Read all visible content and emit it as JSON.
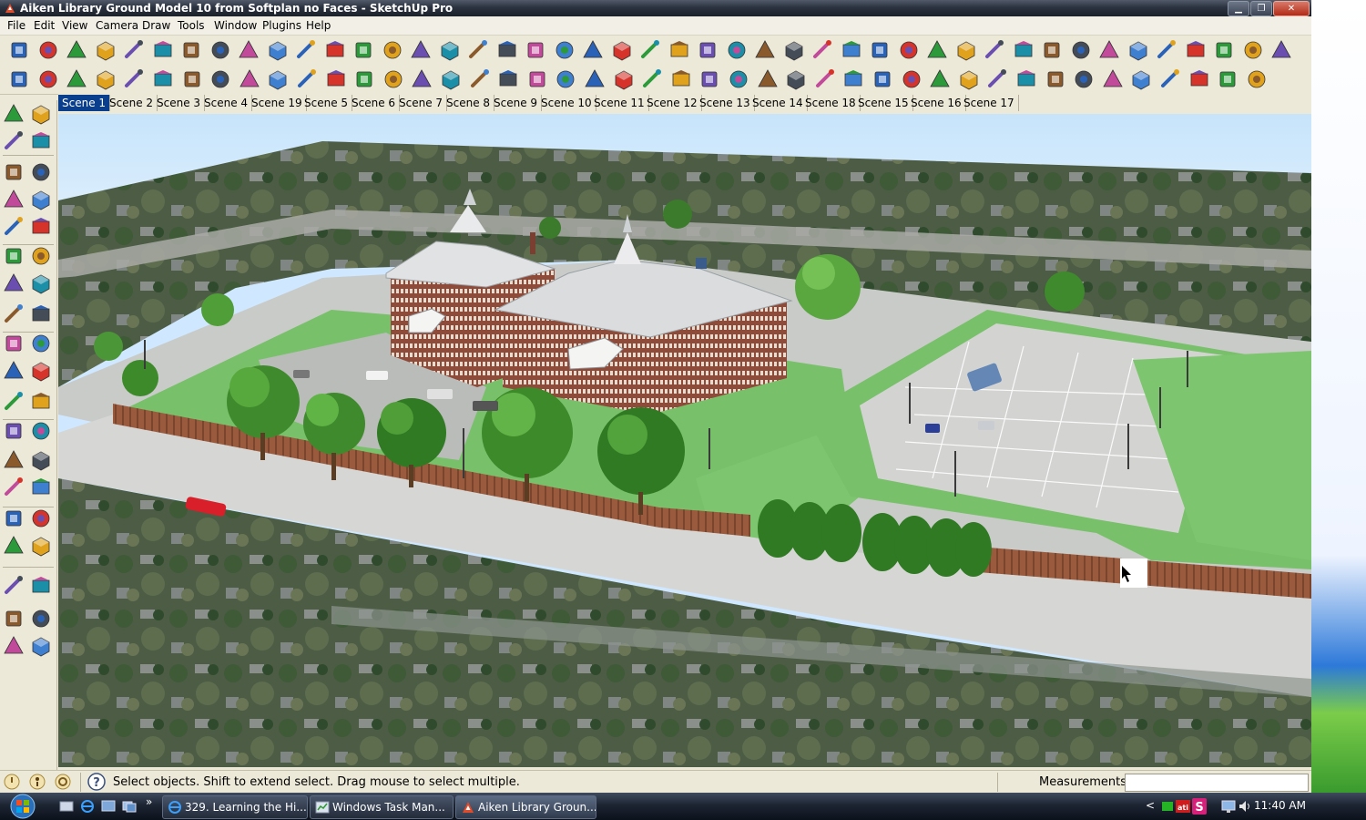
{
  "window": {
    "title": "Aiken Library Ground Model 10  from Softplan no Faces - SketchUp Pro",
    "minimize_glyph": "▁",
    "maximize_glyph": "❐",
    "close_glyph": "✕"
  },
  "menu": [
    "File",
    "Edit",
    "View",
    "Camera",
    "Draw",
    "Tools",
    "Window",
    "Plugins",
    "Help"
  ],
  "toolbar_row1": [
    "new-file",
    "open",
    "save",
    "cut",
    "copy",
    "paste",
    "erase",
    "undo",
    "redo",
    "print",
    "model-info",
    "select",
    "paint",
    "layers",
    "component",
    "section",
    "house",
    "door",
    "window-shape",
    "wall",
    "iso-view",
    "top-view",
    "front-view",
    "right-view",
    "back-view",
    "left-view",
    "x-ray",
    "wireframe",
    "hidden-line",
    "shaded",
    "textured",
    "monochrome",
    "record",
    "walk",
    "prev",
    "previous-scene",
    "box",
    "sphere",
    "cylinder",
    "cone",
    "tube",
    "plane",
    "torus",
    "extrude",
    "push"
  ],
  "toolbar_row2": [
    "power",
    "sun",
    "sunlight",
    "shadow",
    "fog",
    "settings",
    "screen",
    "play",
    "rewind",
    "ut",
    "materials",
    "orbit-tool",
    "line-tool",
    "rotate-tool",
    "pencil",
    "refresh",
    "brush",
    "sphere-dark",
    "green-cube",
    "spiral",
    "pin",
    "delete-x",
    "film1",
    "film2",
    "film3",
    "film4",
    "yellow-lamp",
    "yellow-cone",
    "colors1",
    "colors2",
    "play-blue",
    "stop-blue",
    "record-red",
    "cancel",
    "grid",
    "filter",
    "help",
    "layer-a",
    "layer-b",
    "layer-c",
    "layer-d",
    "layer-e",
    "layer-f",
    "layer-g"
  ],
  "scenes": {
    "active": "Scene 1",
    "tabs": [
      "Scene 1",
      "Scene 2",
      "Scene 3",
      "Scene 4",
      "Scene 19",
      "Scene 5",
      "Scene 6",
      "Scene 7",
      "Scene 8",
      "Scene 9",
      "Scene 10",
      "Scene 11",
      "Scene 12",
      "Scene 13",
      "Scene 14",
      "Scene 18",
      "Scene 15",
      "Scene 16",
      "Scene 17"
    ]
  },
  "palette": [
    "select",
    "make-component",
    "paint-bucket",
    "eraser",
    "rectangle",
    "line",
    "circle",
    "arc",
    "polygon",
    "freehand",
    "move",
    "push-pull",
    "rotate",
    "follow-me",
    "scale",
    "offset",
    "tape-measure",
    "dimension",
    "protractor",
    "text",
    "axes",
    "3d-text",
    "orbit",
    "pan",
    "zoom",
    "zoom-extents",
    "previous-view",
    "next-view",
    "position-camera",
    "look-around",
    "walk",
    "section-plane",
    "layer-1",
    "layer-2",
    "layer-3",
    "layer-4",
    "layer-5",
    "layer-6"
  ],
  "status": {
    "text": "Select objects. Shift to extend select. Drag mouse to select multiple.",
    "measurements_label": "Measurements",
    "measurements_value": ""
  },
  "taskbar": {
    "tasks": [
      {
        "label": "329. Learning the Hi...",
        "icon": "ie-icon"
      },
      {
        "label": "Windows Task Man...",
        "icon": "task-manager-icon"
      },
      {
        "label": "Aiken Library Groun...",
        "icon": "sketchup-icon"
      }
    ],
    "quick_launch_more": "»",
    "tray_arrow": "<",
    "clock": "11:40 AM"
  }
}
